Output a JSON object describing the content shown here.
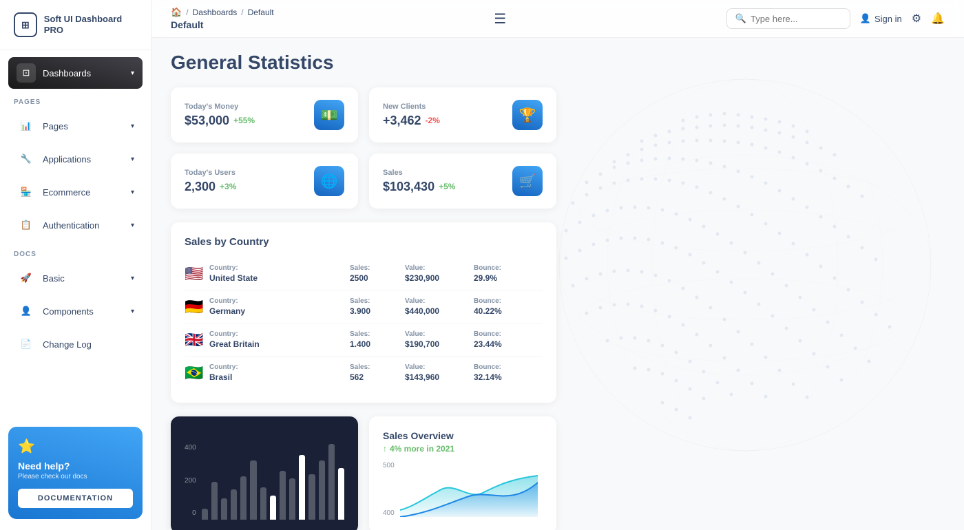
{
  "sidebar": {
    "logo": {
      "icon": "⊞",
      "text": "Soft UI Dashboard PRO"
    },
    "sections": [
      {
        "items": [
          {
            "id": "dashboards",
            "label": "Dashboards",
            "icon": "⊡",
            "active": true,
            "hasChevron": true
          }
        ]
      },
      {
        "label": "PAGES",
        "items": [
          {
            "id": "pages",
            "label": "Pages",
            "icon": "📊",
            "active": false,
            "hasChevron": true
          },
          {
            "id": "applications",
            "label": "Applications",
            "icon": "🔧",
            "active": false,
            "hasChevron": true
          },
          {
            "id": "ecommerce",
            "label": "Ecommerce",
            "icon": "🏪",
            "active": false,
            "hasChevron": true
          },
          {
            "id": "authentication",
            "label": "Authentication",
            "icon": "📋",
            "active": false,
            "hasChevron": true
          }
        ]
      },
      {
        "label": "DOCS",
        "items": [
          {
            "id": "basic",
            "label": "Basic",
            "icon": "🚀",
            "active": false,
            "hasChevron": true
          },
          {
            "id": "components",
            "label": "Components",
            "icon": "👤",
            "active": false,
            "hasChevron": true
          },
          {
            "id": "changelog",
            "label": "Change Log",
            "icon": "📄",
            "active": false,
            "hasChevron": false
          }
        ]
      }
    ],
    "help": {
      "star": "⭐",
      "title": "Need help?",
      "subtitle": "Please check our docs",
      "button_label": "DOCUMENTATION"
    }
  },
  "header": {
    "breadcrumb": {
      "home_icon": "🏠",
      "items": [
        "Dashboards",
        "Default"
      ]
    },
    "page_title": "Default",
    "hamburger": "☰",
    "search_placeholder": "Type here...",
    "sign_in_label": "Sign in",
    "settings_icon": "⚙",
    "bell_icon": "🔔"
  },
  "main": {
    "heading": "General Statistics",
    "stats": [
      {
        "label": "Today's Money",
        "value": "$53,000",
        "change": "+55%",
        "change_type": "pos",
        "icon": "💵",
        "icon_label": "money-icon"
      },
      {
        "label": "New Clients",
        "value": "+3,462",
        "change": "-2%",
        "change_type": "neg",
        "icon": "🏆",
        "icon_label": "clients-icon"
      },
      {
        "label": "Today's Users",
        "value": "2,300",
        "change": "+3%",
        "change_type": "pos",
        "icon": "🌐",
        "icon_label": "users-icon"
      },
      {
        "label": "Sales",
        "value": "$103,430",
        "change": "+5%",
        "change_type": "pos",
        "icon": "🛒",
        "icon_label": "sales-icon"
      }
    ],
    "sales_by_country": {
      "title": "Sales by Country",
      "columns": [
        "Country:",
        "Sales:",
        "Value:",
        "Bounce:"
      ],
      "rows": [
        {
          "flag": "🇺🇸",
          "country": "United State",
          "sales": "2500",
          "value": "$230,900",
          "bounce": "29.9%"
        },
        {
          "flag": "🇩🇪",
          "country": "Germany",
          "sales": "3.900",
          "value": "$440,000",
          "bounce": "40.22%"
        },
        {
          "flag": "🇬🇧",
          "country": "Great Britain",
          "sales": "1.400",
          "value": "$190,700",
          "bounce": "23.44%"
        },
        {
          "flag": "🇧🇷",
          "country": "Brasil",
          "sales": "562",
          "value": "$143,960",
          "bounce": "32.14%"
        }
      ]
    },
    "bar_chart": {
      "y_labels": [
        "400",
        "200",
        "0"
      ],
      "bars": [
        10,
        35,
        20,
        28,
        40,
        55,
        30,
        22,
        45,
        38,
        60,
        42,
        55,
        70,
        48
      ],
      "highlights": [
        7,
        10,
        14
      ]
    },
    "sales_overview": {
      "title": "Sales Overview",
      "subtitle": "4% more in 2021",
      "y_labels": [
        "500",
        "400"
      ]
    }
  }
}
